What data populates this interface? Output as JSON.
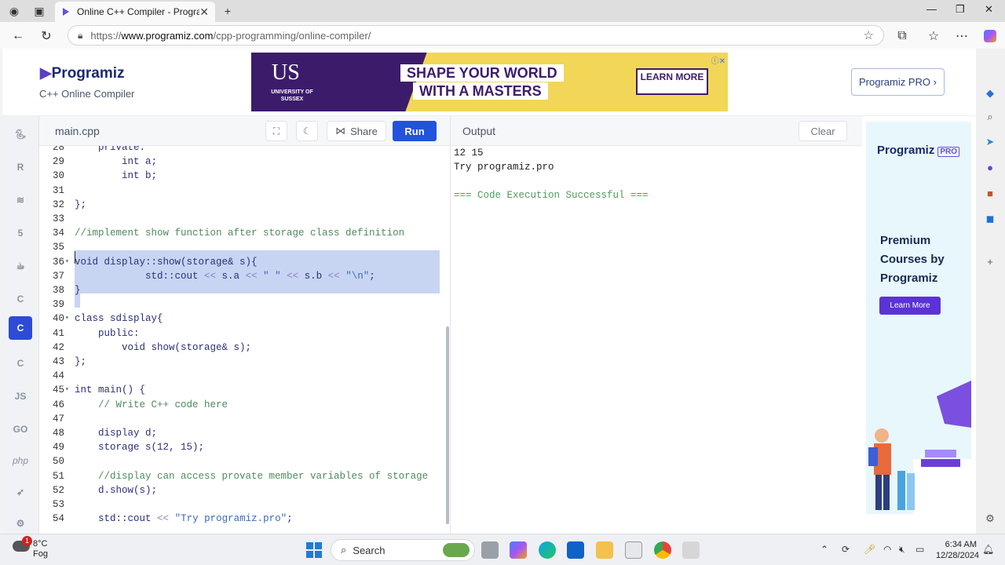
{
  "browser": {
    "tab_title": "Online C++ Compiler - Programiz",
    "url_prefix": "https://",
    "url_host": "www.programiz.com",
    "url_path": "/cpp-programming/online-compiler/"
  },
  "header": {
    "logo": "Programiz",
    "subtitle": "C++ Online Compiler",
    "pro_button": "Programiz PRO ›"
  },
  "ad_banner": {
    "university_mark": "US",
    "university_name": "UNIVERSITY OF SUSSEX",
    "line1": "SHAPE YOUR WORLD",
    "line2": "WITH A MASTERS",
    "cta": "LEARN MORE"
  },
  "languages": [
    "python",
    "r",
    "sql",
    "html",
    "java",
    "c",
    "cpp",
    "csharp",
    "js",
    "go",
    "php",
    "swift",
    "rust"
  ],
  "editor": {
    "file_name": "main.cpp",
    "share_label": "Share",
    "run_label": "Run",
    "lines": [
      {
        "n": "28",
        "fold": "",
        "code": "    private:"
      },
      {
        "n": "29",
        "fold": "",
        "code": "        int a;"
      },
      {
        "n": "30",
        "fold": "",
        "code": "        int b;"
      },
      {
        "n": "31",
        "fold": "",
        "code": ""
      },
      {
        "n": "32",
        "fold": "",
        "code": "};"
      },
      {
        "n": "33",
        "fold": "",
        "code": ""
      },
      {
        "n": "34",
        "fold": "",
        "code": "//implement show function after storage class definition"
      },
      {
        "n": "35",
        "fold": "",
        "code": ""
      },
      {
        "n": "36",
        "fold": "▾",
        "code": "void display::show(storage& s){"
      },
      {
        "n": "37",
        "fold": "",
        "code": "            std::cout << s.a << \" \" << s.b << \"\\n\";"
      },
      {
        "n": "38",
        "fold": "",
        "code": "}"
      },
      {
        "n": "39",
        "fold": "",
        "code": ""
      },
      {
        "n": "40",
        "fold": "▾",
        "code": "class sdisplay{"
      },
      {
        "n": "41",
        "fold": "",
        "code": "    public:"
      },
      {
        "n": "42",
        "fold": "",
        "code": "        void show(storage& s);"
      },
      {
        "n": "43",
        "fold": "",
        "code": "};"
      },
      {
        "n": "44",
        "fold": "",
        "code": ""
      },
      {
        "n": "45",
        "fold": "▾",
        "code": "int main() {"
      },
      {
        "n": "46",
        "fold": "",
        "code": "    // Write C++ code here"
      },
      {
        "n": "47",
        "fold": "",
        "code": ""
      },
      {
        "n": "48",
        "fold": "",
        "code": "    display d;"
      },
      {
        "n": "49",
        "fold": "",
        "code": "    storage s(12, 15);"
      },
      {
        "n": "50",
        "fold": "",
        "code": ""
      },
      {
        "n": "51",
        "fold": "",
        "code": "    //display can access provate member variables of storage"
      },
      {
        "n": "52",
        "fold": "",
        "code": "    d.show(s);"
      },
      {
        "n": "53",
        "fold": "",
        "code": ""
      },
      {
        "n": "54",
        "fold": "",
        "code": "    std::cout << \"Try programiz.pro\";"
      }
    ]
  },
  "output": {
    "title": "Output",
    "clear_label": "Clear",
    "lines": [
      "12 15",
      "Try programiz.pro",
      "",
      "=== Code Execution Successful ==="
    ]
  },
  "side_ad": {
    "brand": "Programiz",
    "badge": "PRO",
    "headline": "Premium Courses by Programiz",
    "cta": "Learn More"
  },
  "taskbar": {
    "temperature": "8°C",
    "weather": "Fog",
    "notification_count": "1",
    "search_label": "Search",
    "time": "6:34 AM",
    "date": "12/28/2024"
  }
}
